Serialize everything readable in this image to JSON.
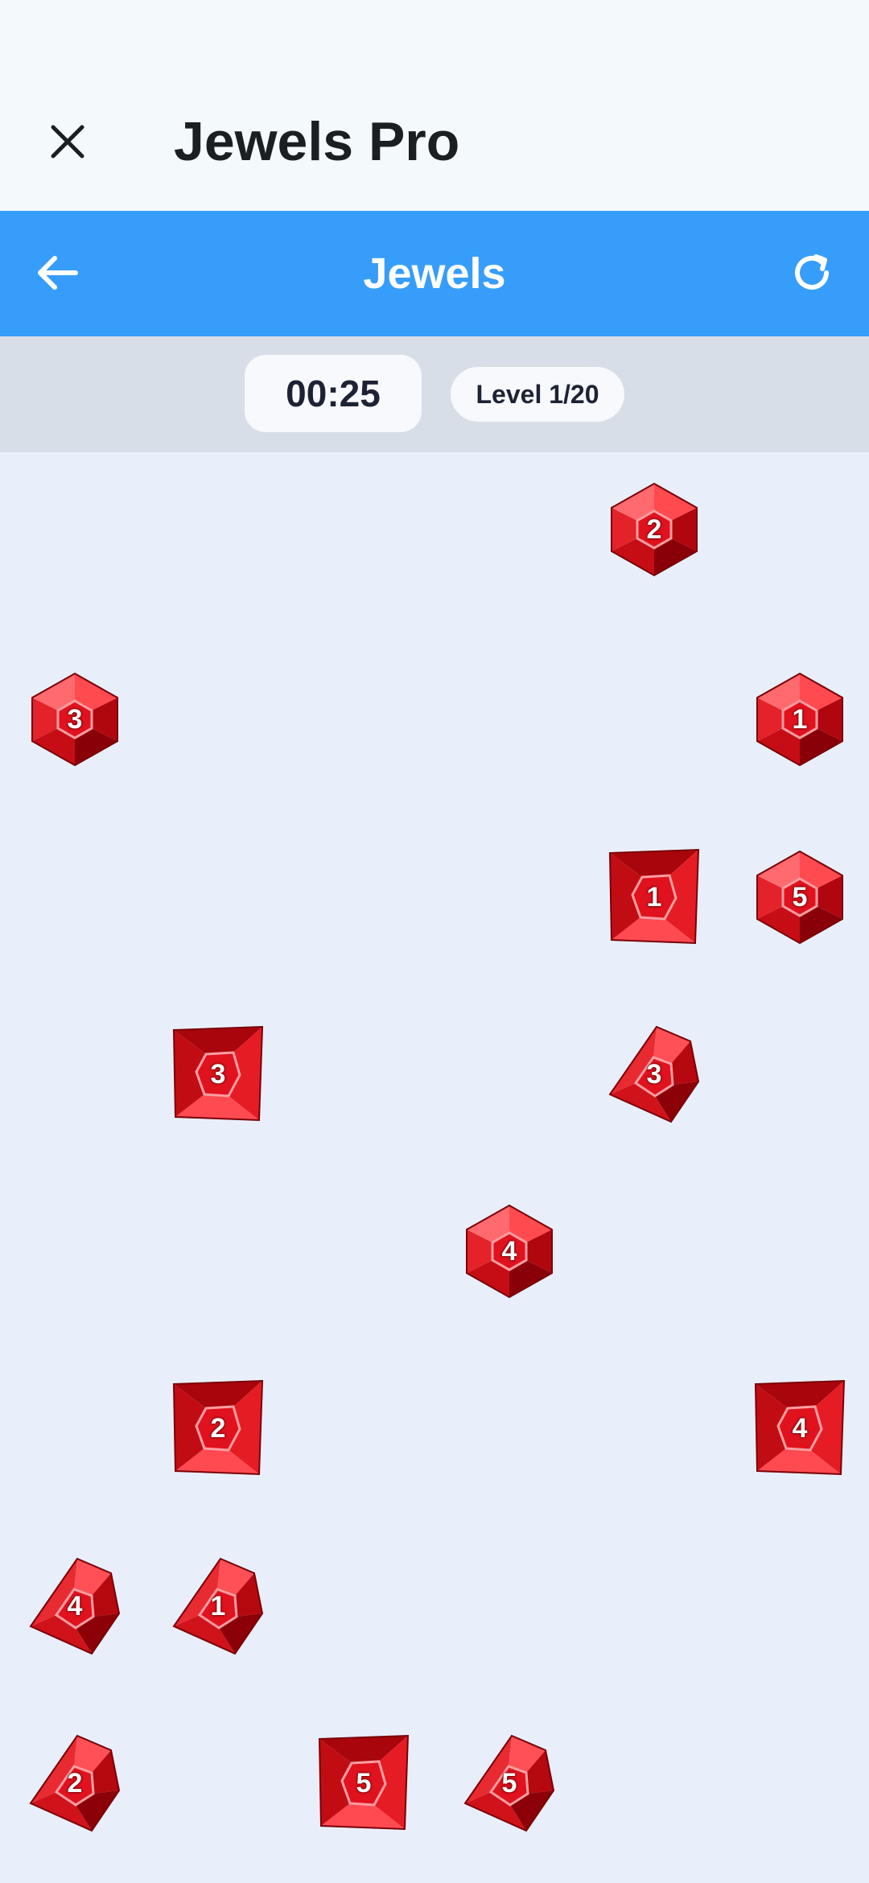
{
  "app": {
    "title": "Jewels Pro"
  },
  "nav": {
    "title": "Jewels"
  },
  "status": {
    "timer": "00:25",
    "level": "Level 1/20"
  },
  "colors": {
    "header_blue": "#379dfb",
    "board_bg": "#e8effb",
    "gem_red": "#e0121e"
  },
  "icons": {
    "close": "close-icon",
    "back": "arrow-left-icon",
    "refresh": "refresh-icon"
  },
  "gems": [
    {
      "num": "2",
      "shape": "hex"
    },
    {
      "num": "3",
      "shape": "hex"
    },
    {
      "num": "1",
      "shape": "hex"
    },
    {
      "num": "1",
      "shape": "square"
    },
    {
      "num": "5",
      "shape": "hex"
    },
    {
      "num": "3",
      "shape": "square"
    },
    {
      "num": "3",
      "shape": "pent"
    },
    {
      "num": "4",
      "shape": "hex"
    },
    {
      "num": "2",
      "shape": "square"
    },
    {
      "num": "4",
      "shape": "square"
    },
    {
      "num": "4",
      "shape": "pent"
    },
    {
      "num": "1",
      "shape": "pent"
    },
    {
      "num": "2",
      "shape": "pent"
    },
    {
      "num": "5",
      "shape": "square"
    },
    {
      "num": "5",
      "shape": "pent"
    }
  ]
}
